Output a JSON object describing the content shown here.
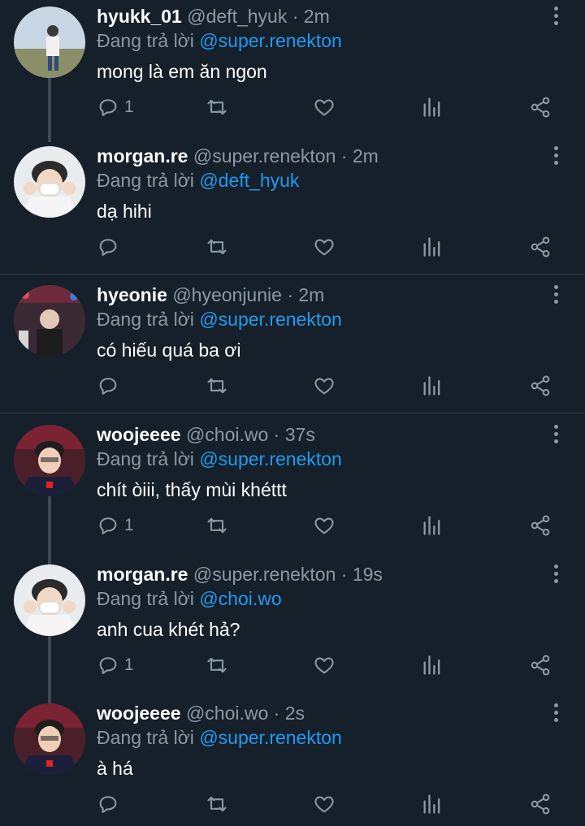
{
  "reply_prefix": "Đang trả lời ",
  "dot": "·",
  "more_icon": "more-vertical-icon",
  "colors": {
    "background": "#15202b",
    "link": "#1d9bf0",
    "muted": "#8b98a5",
    "divider": "#38444d"
  },
  "tweets": [
    {
      "name": "hyukk_01",
      "handle": "@deft_hyuk",
      "time": "2m",
      "reply_to": "@super.renekton",
      "text": "mong là em ăn ngon",
      "reply_count": "1"
    },
    {
      "name": "morgan.re",
      "handle": "@super.renekton",
      "time": "2m",
      "reply_to": "@deft_hyuk",
      "text": "dạ hihi",
      "reply_count": ""
    },
    {
      "name": "hyeonie",
      "handle": "@hyeonjunie",
      "time": "2m",
      "reply_to": "@super.renekton",
      "text": "có hiếu quá ba ơi",
      "reply_count": ""
    },
    {
      "name": "woojeeee",
      "handle": "@choi.wo",
      "time": "37s",
      "reply_to": "@super.renekton",
      "text": "chít òiii, thấy mùi khéttt",
      "reply_count": "1"
    },
    {
      "name": "morgan.re",
      "handle": "@super.renekton",
      "time": "19s",
      "reply_to": "@choi.wo",
      "text": "anh cua khét hả?",
      "reply_count": "1"
    },
    {
      "name": "woojeeee",
      "handle": "@choi.wo",
      "time": "2s",
      "reply_to": "@super.renekton",
      "text": "à há",
      "reply_count": ""
    }
  ]
}
